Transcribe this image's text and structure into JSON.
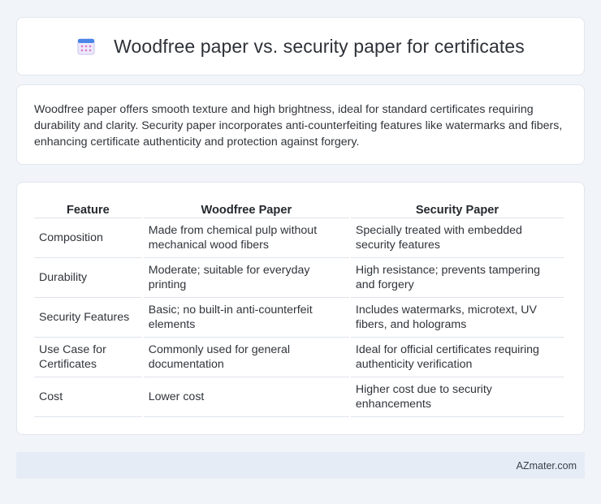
{
  "header": {
    "icon": "calendar-icon",
    "title": "Woodfree paper vs. security paper for certificates"
  },
  "summary": "Woodfree paper offers smooth texture and high brightness, ideal for standard certificates requiring durability and clarity. Security paper incorporates anti-counterfeiting features like watermarks and fibers, enhancing certificate authenticity and protection against forgery.",
  "table": {
    "headers": [
      "Feature",
      "Woodfree Paper",
      "Security Paper"
    ],
    "rows": [
      [
        "Composition",
        "Made from chemical pulp without mechanical wood fibers",
        "Specially treated with embedded security features"
      ],
      [
        "Durability",
        "Moderate; suitable for everyday printing",
        "High resistance; prevents tampering and forgery"
      ],
      [
        "Security Features",
        "Basic; no built-in anti-counterfeit elements",
        "Includes watermarks, microtext, UV fibers, and holograms"
      ],
      [
        "Use Case for Certificates",
        "Commonly used for general documentation",
        "Ideal for official certificates requiring authenticity verification"
      ],
      [
        "Cost",
        "Lower cost",
        "Higher cost due to security enhancements"
      ]
    ]
  },
  "footer": {
    "brand": "AZmater.com"
  },
  "colors": {
    "background": "#f1f4f9",
    "card": "#ffffff",
    "footer": "#e6ecf6",
    "icon_accent": "#8a7fe0"
  }
}
